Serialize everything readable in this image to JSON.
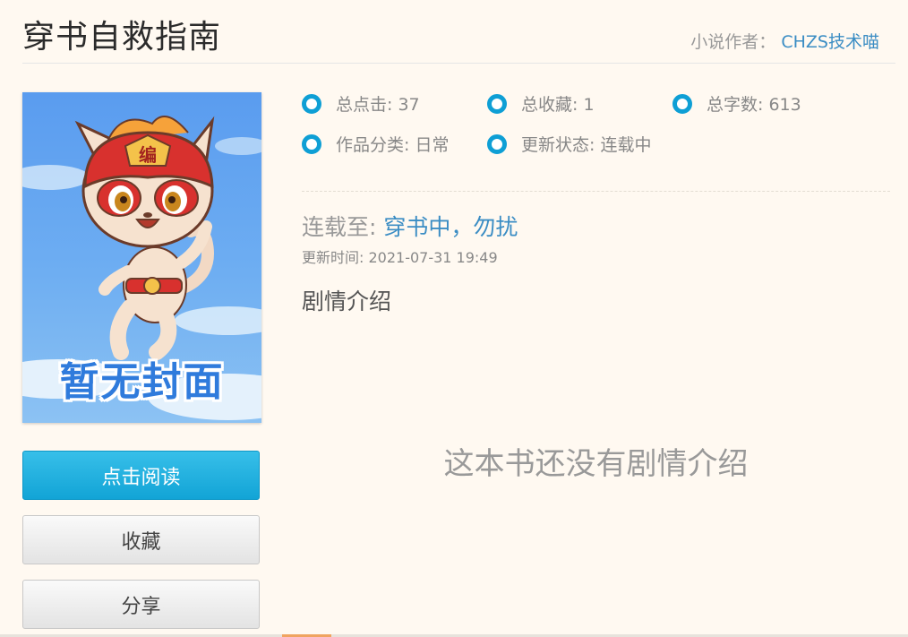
{
  "book": {
    "title": "穿书自救指南",
    "author_label": "小说作者：",
    "author_name": "CHZS技术喵"
  },
  "cover": {
    "text": "暂无封面",
    "badge_char": "编"
  },
  "actions": {
    "read_label": "点击阅读",
    "favorite_label": "收藏",
    "share_label": "分享"
  },
  "stats": {
    "clicks": "总点击: 37",
    "favorites": "总收藏: 1",
    "words": "总字数: 613",
    "category": "作品分类: 日常",
    "status": "更新状态: 连载中"
  },
  "latest": {
    "prefix": "连载至:",
    "chapter": "穿书中，勿扰",
    "update_time": "更新时间: 2021-07-31 19:49"
  },
  "intro": {
    "heading": "剧情介绍",
    "empty_text": "这本书还没有剧情介绍"
  },
  "colors": {
    "accent_blue": "#0e9fd5",
    "link_blue": "#3b8dc4",
    "background": "#fff9f1"
  }
}
